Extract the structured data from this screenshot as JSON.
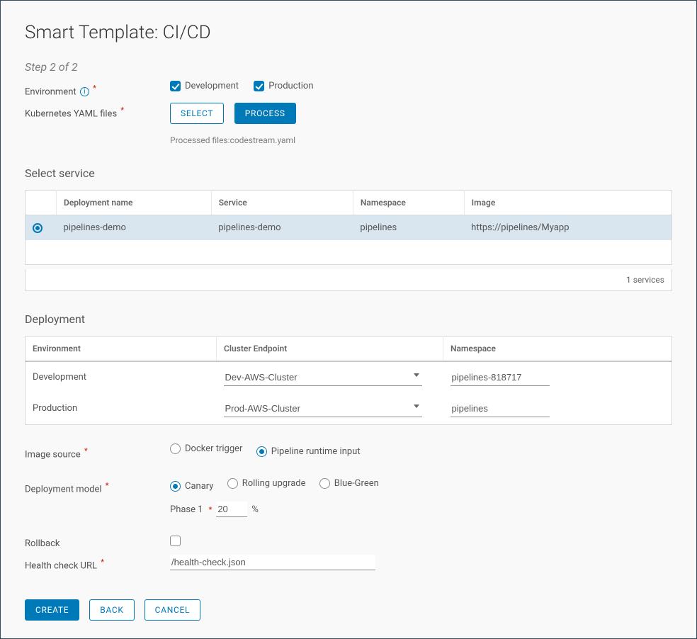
{
  "title": "Smart Template: CI/CD",
  "step_label": "Step 2 of 2",
  "labels": {
    "environment": "Environment",
    "yaml_files": "Kubernetes YAML files",
    "select_service": "Select service",
    "deployment": "Deployment",
    "image_source": "Image source",
    "deployment_model": "Deployment model",
    "rollback": "Rollback",
    "health_check": "Health check URL",
    "phase": "Phase 1",
    "percent": "%"
  },
  "env": {
    "development": {
      "label": "Development",
      "checked": true
    },
    "production": {
      "label": "Production",
      "checked": true
    }
  },
  "buttons": {
    "select": "SELECT",
    "process": "PROCESS",
    "create": "CREATE",
    "back": "BACK",
    "cancel": "CANCEL"
  },
  "processed_note": "Processed files:codestream.yaml",
  "service_table": {
    "headers": [
      "Deployment name",
      "Service",
      "Namespace",
      "Image"
    ],
    "rows": [
      {
        "deployment": "pipelines-demo",
        "service": "pipelines-demo",
        "namespace": "pipelines",
        "image": "https://pipelines/Myapp"
      }
    ],
    "footer": "1 services"
  },
  "deployment_table": {
    "headers": [
      "Environment",
      "Cluster Endpoint",
      "Namespace"
    ],
    "rows": [
      {
        "env": "Development",
        "cluster": "Dev-AWS-Cluster",
        "namespace": "pipelines-818717"
      },
      {
        "env": "Production",
        "cluster": "Prod-AWS-Cluster",
        "namespace": "pipelines"
      }
    ]
  },
  "image_source_options": {
    "docker": "Docker trigger",
    "runtime": "Pipeline runtime input",
    "selected": "runtime"
  },
  "deployment_model_options": {
    "canary": "Canary",
    "rolling": "Rolling upgrade",
    "bluegreen": "Blue-Green",
    "selected": "canary"
  },
  "phase_value": "20",
  "health_check_value": "/health-check.json"
}
